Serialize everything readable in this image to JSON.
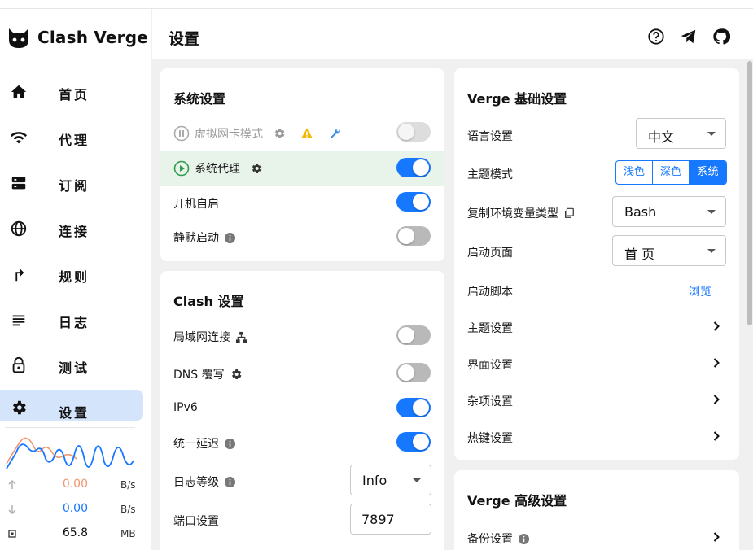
{
  "app": {
    "name": "Clash Verge"
  },
  "sidebar": {
    "items": [
      {
        "label": "首页",
        "icon": "home-icon"
      },
      {
        "label": "代理",
        "icon": "wifi-icon"
      },
      {
        "label": "订阅",
        "icon": "storage-icon"
      },
      {
        "label": "连接",
        "icon": "globe-icon"
      },
      {
        "label": "规则",
        "icon": "fork-icon"
      },
      {
        "label": "日志",
        "icon": "lines-icon"
      },
      {
        "label": "测试",
        "icon": "lock-icon"
      },
      {
        "label": "设置",
        "icon": "gear-icon",
        "active": true
      }
    ]
  },
  "traffic": {
    "up": {
      "value": "0.00",
      "unit": "B/s"
    },
    "down": {
      "value": "0.00",
      "unit": "B/s"
    },
    "memory": {
      "value": "65.8",
      "unit": "MB"
    }
  },
  "header": {
    "title": "设置"
  },
  "system_settings": {
    "title": "系统设置",
    "tun_mode": {
      "label": "虚拟网卡模式",
      "state": "disabled"
    },
    "system_proxy": {
      "label": "系统代理",
      "state": "on"
    },
    "auto_launch": {
      "label": "开机自启",
      "state": "on"
    },
    "silent_start": {
      "label": "静默启动",
      "state": "off"
    }
  },
  "clash_settings": {
    "title": "Clash 设置",
    "lan": {
      "label": "局域网连接",
      "state": "off"
    },
    "dns": {
      "label": "DNS 覆写",
      "state": "off"
    },
    "ipv6": {
      "label": "IPv6",
      "state": "on"
    },
    "unified_delay": {
      "label": "统一延迟",
      "state": "on"
    },
    "log_level": {
      "label": "日志等级",
      "value": "Info"
    },
    "port": {
      "label": "端口设置",
      "value": "7897"
    }
  },
  "verge_basic": {
    "title": "Verge 基础设置",
    "language": {
      "label": "语言设置",
      "value": "中文"
    },
    "theme_mode": {
      "label": "主题模式",
      "options": [
        "浅色",
        "深色",
        "系统"
      ],
      "selected": "系统"
    },
    "env_type": {
      "label": "复制环境变量类型",
      "value": "Bash"
    },
    "start_page": {
      "label": "启动页面",
      "value": "首 页"
    },
    "start_script": {
      "label": "启动脚本",
      "action": "浏览"
    },
    "theme_settings": {
      "label": "主题设置"
    },
    "layout_settings": {
      "label": "界面设置"
    },
    "misc_settings": {
      "label": "杂项设置"
    },
    "hotkey_settings": {
      "label": "热键设置"
    }
  },
  "verge_advanced": {
    "title": "Verge 高级设置",
    "backup": {
      "label": "备份设置"
    }
  },
  "colors": {
    "accent": "#1677ff",
    "active_nav": "#d4e5fb",
    "upload": "#f0966f",
    "download": "#1677ff",
    "success": "#2e9b4f",
    "warning": "#f5b800"
  }
}
